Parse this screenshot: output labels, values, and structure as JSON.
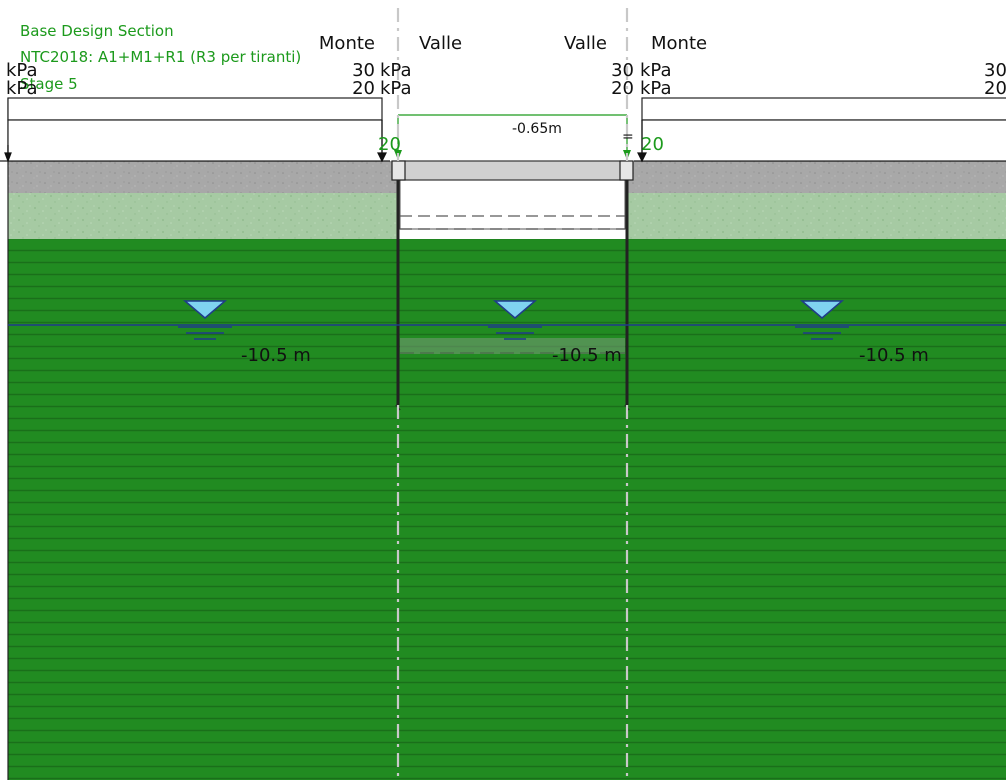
{
  "header": {
    "section_name": "Base Design Section",
    "design_approach": "NTC2018: A1+M1+R1 (R3 per tiranti)",
    "stage": "Stage 5"
  },
  "sides": {
    "left_upstream": "Monte",
    "excavation_left": "Valle",
    "excavation_right": "Valle",
    "right_upstream": "Monte"
  },
  "surcharges": {
    "load_1": {
      "value": "30",
      "unit": "kPa"
    },
    "load_2": {
      "value": "20",
      "unit": "kPa"
    },
    "unit_only": "kPa"
  },
  "strut": {
    "elevation_label": "-0.65m",
    "left_tag": "20",
    "right_tag": "20"
  },
  "water_table": {
    "label": "-10.5 m",
    "label_center": "-10.5 m"
  },
  "colors": {
    "clay_green": "#218b21",
    "clay_stripe": "#1a6f1a",
    "gravel_gray": "#a8a8a8",
    "sand_light_green": "#a6caa3",
    "water_line": "#1f3b8a",
    "water_symbol": "#7fd3f0",
    "annotation_green": "#1c9a1c",
    "axis_gray": "#c8c8c8"
  }
}
